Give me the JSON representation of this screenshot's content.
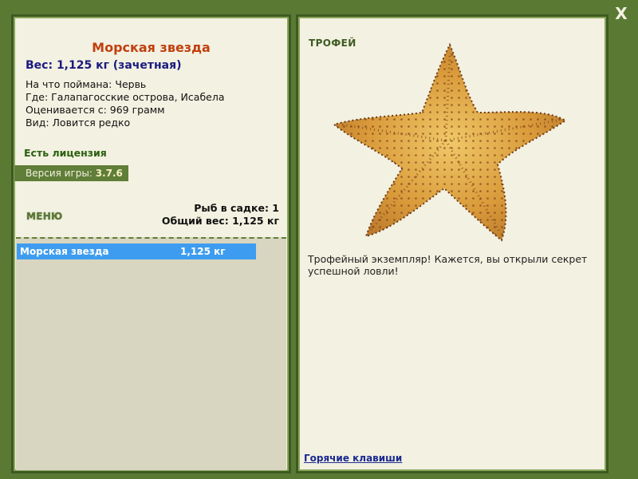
{
  "window": {
    "close_label": "X"
  },
  "fish": {
    "title": "Морская звезда",
    "weight_line": "Вес: 1,125 кг (зачетная)",
    "caught_with": "На что поймана: Червь",
    "location": "Где: Галапагосские острова, Исабела",
    "valued_from": "Оценивается с: 969 грамм",
    "rarity": "Вид: Ловится редко"
  },
  "license": "Есть лицензия",
  "version": {
    "label": "Версия игры:",
    "value": "3.7.6"
  },
  "menu": {
    "label": "МЕНЮ"
  },
  "stats": {
    "fish_count": "Рыб в садке: 1",
    "total_weight": "Общий вес: 1,125 кг"
  },
  "catch_list": [
    {
      "name": "Морская звезда",
      "weight": "1,125 кг"
    }
  ],
  "trophy": {
    "label": "ТРОФЕЙ",
    "description": "Трофейный экземпляр! Кажется, вы открыли секрет успешной ловли!",
    "image": "starfish-image"
  },
  "hotkeys_label": "Горячие клавиши",
  "colors": {
    "background": "#5a7a34",
    "panel": "#f3f1e1",
    "title": "#c04010",
    "weight": "#1a1a80",
    "selection": "#3d9cf0"
  }
}
